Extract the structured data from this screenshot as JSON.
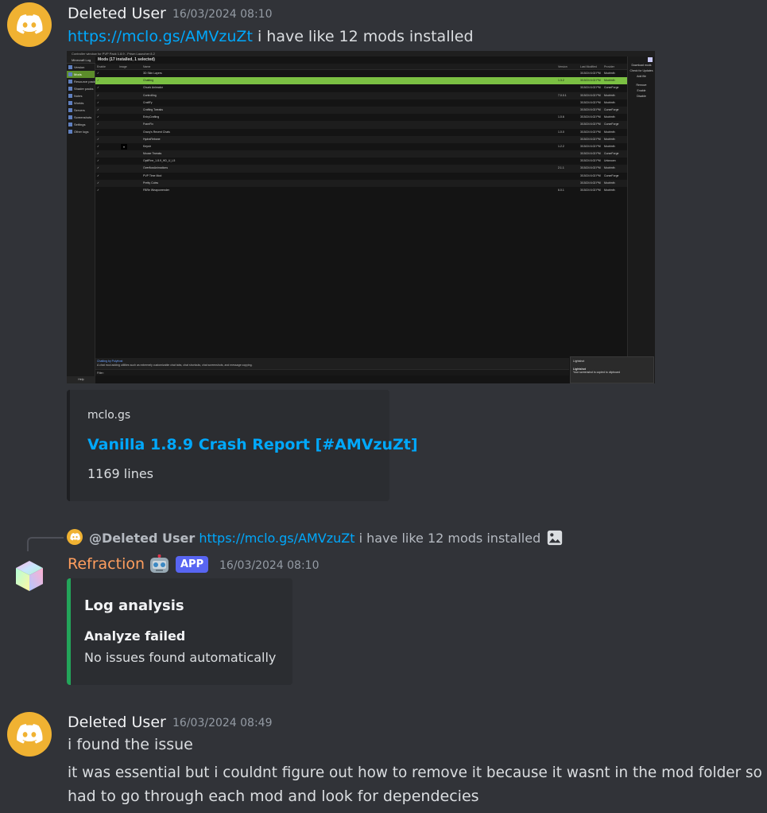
{
  "messages": [
    {
      "username": "Deleted User",
      "timestamp": "16/03/2024 08:10",
      "link": "https://mclo.gs/AMVzuZt",
      "text": "i have like 12 mods installed"
    },
    {
      "username": "Deleted User",
      "timestamp": "16/03/2024 08:49",
      "line1": "i found the issue",
      "line2a": "it was essential but i couldnt figure out how to remove it because it wasnt in the mod folder so i",
      "line2b": "had to go through each mod and look for dependecies"
    }
  ],
  "screenshot": {
    "window_title": "Controller window for PVP Pack 1.8.9 - Prism Launcher 8.2",
    "app_name": "Minecraft Log",
    "header": "Mods (17 installed, 1 selected)",
    "nav": [
      "Version",
      "Mods",
      "Resource packs",
      "Shader packs",
      "Notes",
      "Worlds",
      "Servers",
      "Screenshots",
      "Settings",
      "Other logs"
    ],
    "help": "Help",
    "columns": [
      "Enable",
      "Image",
      "Name",
      "Version",
      "Last Modified",
      "Provider"
    ],
    "rows": [
      {
        "name": "3D Skin Layers",
        "version": "",
        "modified": "3/15/24 6:02 PM",
        "provider": "Modrinth"
      },
      {
        "name": "Chatting",
        "version": "1.3.2",
        "modified": "3/15/24 6:02 PM",
        "provider": "Modrinth"
      },
      {
        "name": "Chunk Animator",
        "version": "",
        "modified": "3/15/24 6:02 PM",
        "provider": "CurseForge"
      },
      {
        "name": "Controlling",
        "version": "7.0.0.1",
        "modified": "3/15/24 6:02 PM",
        "provider": "Modrinth"
      },
      {
        "name": "CraftFy",
        "version": "",
        "modified": "3/15/24 6:02 PM",
        "provider": "Modrinth"
      },
      {
        "name": "Crafting Tweaks",
        "version": "",
        "modified": "3/15/24 6:02 PM",
        "provider": "CurseForge"
      },
      {
        "name": "EnhyCrafting",
        "version": "1.0.6",
        "modified": "3/15/24 6:02 PM",
        "provider": "Modrinth"
      },
      {
        "name": "FramFix",
        "version": "",
        "modified": "3/15/24 6:02 PM",
        "provider": "CurseForge"
      },
      {
        "name": "Gravy's Recent Chats",
        "version": "1.0.0",
        "modified": "3/15/24 6:02 PM",
        "provider": "Modrinth"
      },
      {
        "name": "HydraRebane",
        "version": "",
        "modified": "3/15/24 6:02 PM",
        "provider": "Modrinth"
      },
      {
        "name": "Keystr",
        "version": "1.2.2",
        "modified": "3/15/24 6:02 PM",
        "provider": "Modrinth"
      },
      {
        "name": "Mouse Tweaks",
        "version": "",
        "modified": "3/15/24 6:02 PM",
        "provider": "CurseForge"
      },
      {
        "name": "OptiFine_1.8.9_HD_U_L5",
        "version": "",
        "modified": "3/15/24 6:02 PM",
        "provider": "Unknown"
      },
      {
        "name": "OverflowAnimations",
        "version": "2.1.1",
        "modified": "3/15/24 6:02 PM",
        "provider": "Modrinth"
      },
      {
        "name": "PVP Time Mod",
        "version": "",
        "modified": "3/15/24 6:02 PM",
        "provider": "CurseForge"
      },
      {
        "name": "Pretty Cobw",
        "version": "",
        "modified": "3/15/24 6:02 PM",
        "provider": "Modrinth"
      },
      {
        "name": "FBRe Weaponrender",
        "version": "6.0.1",
        "modified": "3/15/24 6:02 PM",
        "provider": "Modrinth"
      }
    ],
    "right_buttons": [
      "Download mods",
      "Check for Updates",
      "Add file",
      "Remove",
      "Enable",
      "Disable"
    ],
    "desc_line1": "Chatting by Polyfrost",
    "desc_line2": "A chat mod adding utilities such as extremely customizable chat tabs, chat shortcuts, chat screenshots, and message copying.",
    "filter": "Filter:",
    "toast_app": "Lightshot",
    "toast_title": "Lightshot",
    "toast_body": "Your screenshot is copied to clipboard"
  },
  "embed": {
    "site": "mclo.gs",
    "title": "Vanilla 1.8.9 Crash Report [#AMVzuZt]",
    "description": "1169 lines"
  },
  "reply": {
    "mention": "@Deleted User",
    "link": "https://mclo.gs/AMVzuZt",
    "text": "i have like 12 mods installed"
  },
  "bot": {
    "username": "Refraction",
    "badge": "APP",
    "timestamp": "16/03/2024 08:10",
    "embed_title": "Log analysis",
    "field_name": "Analyze failed",
    "field_value": "No issues found automatically"
  },
  "colors": {
    "background": "#313338",
    "link": "#00a8fc",
    "bot_name": "#ff9e5e",
    "app_badge": "#5865f2",
    "embed_accent": "#23a55a",
    "avatar": "#f0b232"
  }
}
